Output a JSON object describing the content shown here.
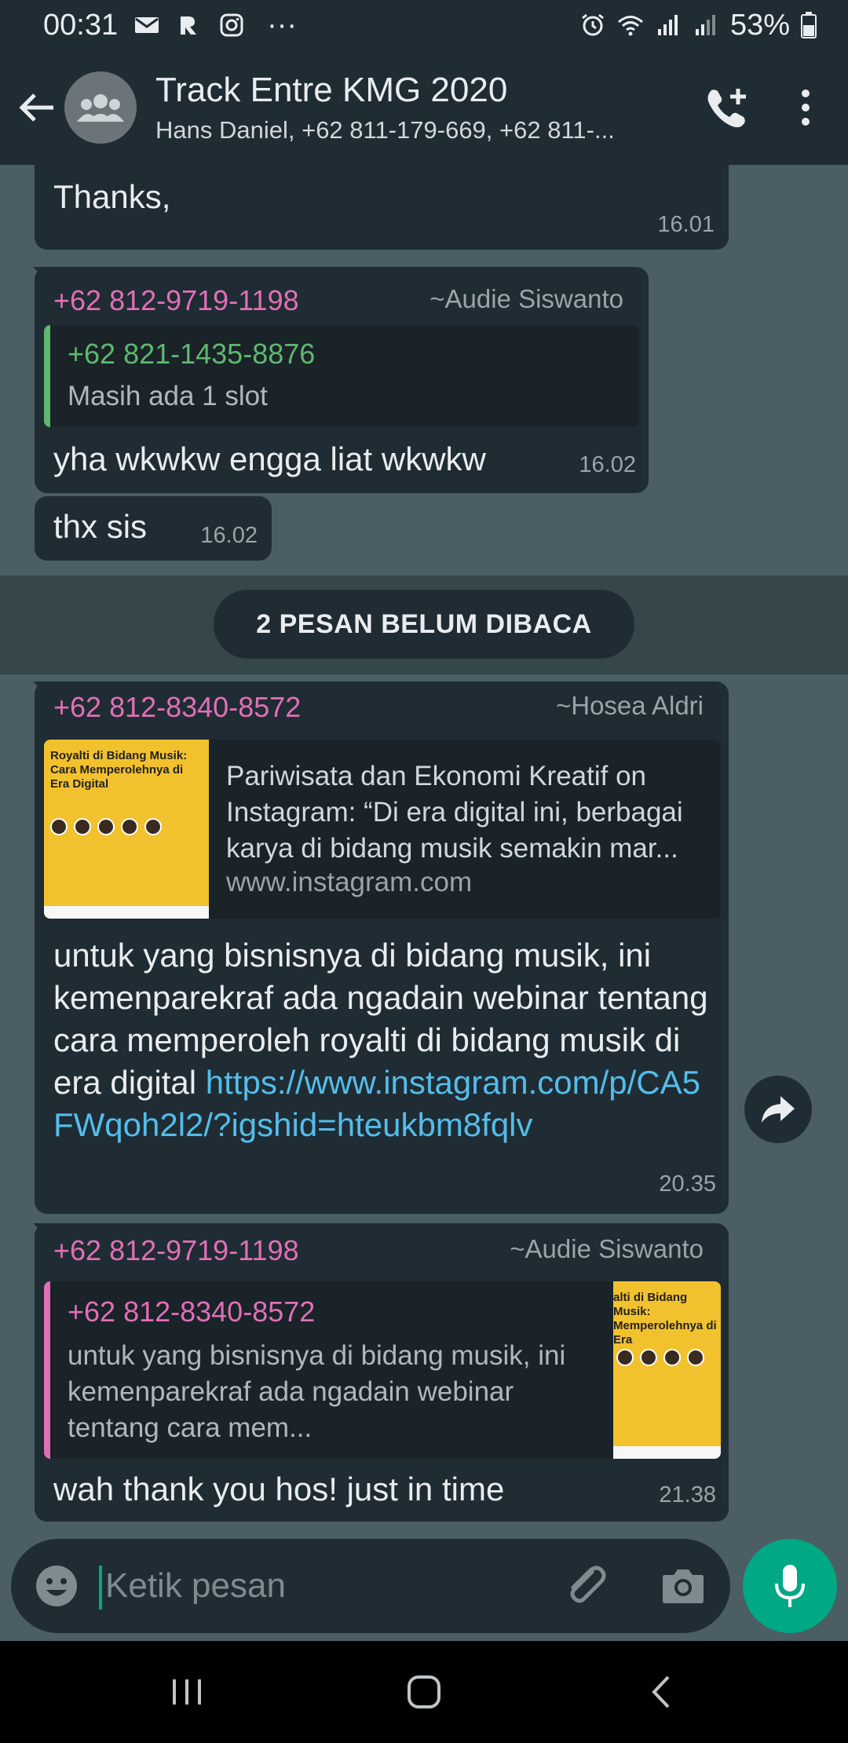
{
  "status_bar": {
    "time": "00:31",
    "battery": "53%",
    "icons": [
      "mail-icon",
      "app-icon",
      "instagram-icon",
      "more-dots-icon",
      "alarm-icon",
      "wifi-icon",
      "signal-icon",
      "signal-icon-2",
      "battery-icon"
    ],
    "dots": "···"
  },
  "header": {
    "title": "Track Entre KMG 2020",
    "subtitle": "Hans Daniel, +62 811-179-669, +62 811-...",
    "icons": [
      "back-arrow-icon",
      "group-avatar-icon",
      "add-call-icon",
      "more-vert-icon"
    ]
  },
  "messages": [
    {
      "text": "Thanks,",
      "time": "16.01"
    },
    {
      "sender": "+62 812-9719-1198",
      "pushname": "~Audie Siswanto",
      "quote": {
        "sender": "+62 821-1435-8876",
        "text": "Masih ada 1 slot"
      },
      "text": "yha wkwkw engga liat wkwkw",
      "time": "16.02"
    },
    {
      "text": "thx sis",
      "time": "16.02"
    }
  ],
  "unread_divider": "2 PESAN BELUM DIBACA",
  "unread_messages": [
    {
      "sender": "+62 812-8340-8572",
      "pushname": "~Hosea Aldri",
      "link_preview": {
        "thumb_title": "Royalti di Bidang Musik: Cara Memperolehnya di Era Digital",
        "text": "Pariwisata dan Ekonomi Kreatif on Instagram: “Di era digital ini, berbagai karya di bidang musik semakin mar...",
        "domain": "www.instagram.com"
      },
      "text_plain": "untuk yang bisnisnya di bidang musik, ini kemenparekraf ada ngadain webinar tentang cara memperoleh royalti di bidang musik di era digital",
      "text_link": "https://www.instagram.com/p/CA5FWqoh2l2/?igshid=hteukbm8fqlv",
      "time": "20.35"
    },
    {
      "sender": "+62 812-9719-1198",
      "pushname": "~Audie Siswanto",
      "quote": {
        "sender": "+62 812-8340-8572",
        "text": "untuk yang bisnisnya di bidang musik, ini kemenparekraf ada ngadain webinar tentang cara mem...",
        "thumb_title": "alti di Bidang Musik: Memperolehnya di Era"
      },
      "text": "wah thank you hos! just in time",
      "time": "21.38"
    }
  ],
  "input": {
    "placeholder": "Ketik pesan",
    "icons": [
      "emoji-icon",
      "attach-icon",
      "camera-icon",
      "mic-icon"
    ]
  },
  "colors": {
    "accent": "#00a884",
    "sender_pink": "#e16fb7",
    "sender_green": "#5fb86f",
    "link": "#53bdeb",
    "chat_bg": "#4a5e64",
    "bubble": "#202c33"
  },
  "nav": {
    "icons": [
      "recent-apps-icon",
      "home-icon",
      "back-icon"
    ]
  }
}
